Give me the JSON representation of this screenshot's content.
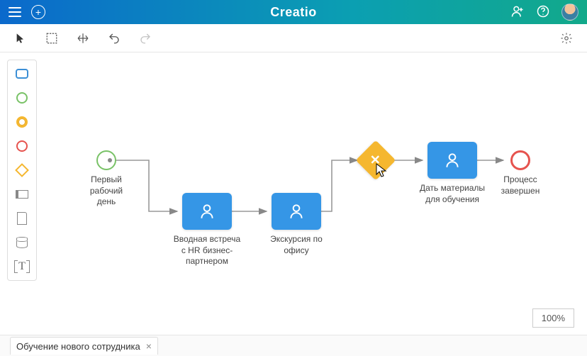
{
  "header": {
    "logo": "Creatio"
  },
  "palette": {
    "items": [
      {
        "name": "rounded-rect",
        "tip": "Task"
      },
      {
        "name": "circle-green",
        "tip": "Start event"
      },
      {
        "name": "circle-yellow",
        "tip": "Intermediate event"
      },
      {
        "name": "circle-red",
        "tip": "End event"
      },
      {
        "name": "diamond",
        "tip": "Gateway"
      },
      {
        "name": "lane",
        "tip": "Lane"
      },
      {
        "name": "document",
        "tip": "Document"
      },
      {
        "name": "database",
        "tip": "Data store"
      },
      {
        "name": "text",
        "tip": "Text annotation"
      }
    ]
  },
  "diagram": {
    "nodes": {
      "start": {
        "label": "Первый рабочий\nдень"
      },
      "task1": {
        "label": "Вводная встреча\nс HR бизнес-\nпартнером"
      },
      "task2": {
        "label": "Экскурсия по\nофису"
      },
      "gateway": {
        "label": ""
      },
      "task3": {
        "label": "Дать материалы\nдля обучения"
      },
      "end": {
        "label": "Процесс\nзавершен"
      }
    }
  },
  "zoom": "100%",
  "footer": {
    "tab_label": "Обучение нового сотрудника"
  }
}
